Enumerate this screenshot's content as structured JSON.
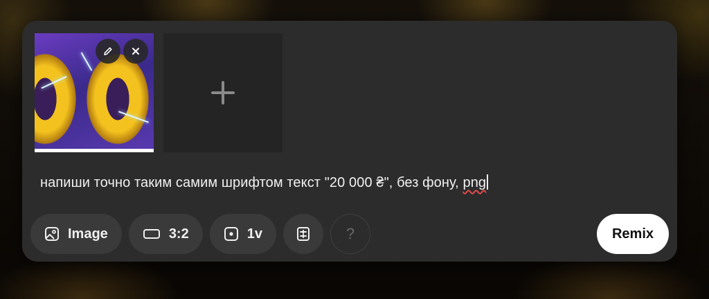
{
  "composer": {
    "prompt_text": "напиши точно таким самим шрифтом текст \"20 000 ₴\", без фону, ",
    "prompt_misspelled_word": "png",
    "attachments": [
      {
        "type": "image",
        "edit_icon": "pencil-icon",
        "remove_icon": "close-icon"
      }
    ],
    "add_tile_icon": "plus-icon"
  },
  "toolbar": {
    "image_label": "Image",
    "image_icon": "image-icon",
    "aspect_label": "3:2",
    "aspect_icon": "rectangle-icon",
    "variations_label": "1v",
    "variations_icon": "square-dot-icon",
    "preset_icon": "document-sliders-icon",
    "help_label": "?",
    "remix_label": "Remix"
  },
  "colors": {
    "panel": "#2c2c2c",
    "pill": "#3a3a3a",
    "primary_button": "#ffffff",
    "spellcheck": "#e04a4a"
  }
}
